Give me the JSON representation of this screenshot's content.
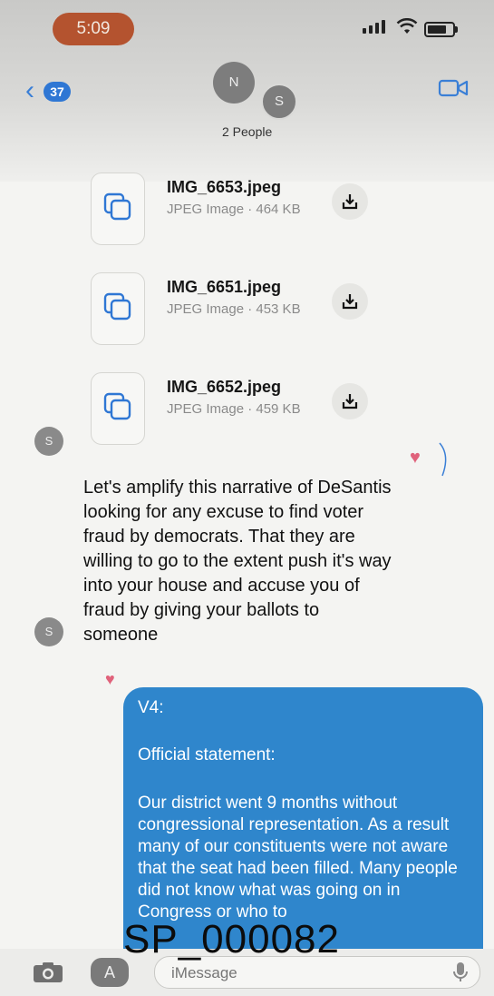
{
  "status_bar": {
    "time": "5:09"
  },
  "header": {
    "back_count": "37",
    "avatars": [
      "N",
      "S"
    ],
    "group_label": "2 People"
  },
  "attachments": [
    {
      "filename": "IMG_6653.jpeg",
      "meta": "JPEG Image · 464 KB"
    },
    {
      "filename": "IMG_6651.jpeg",
      "meta": "JPEG Image · 453 KB"
    },
    {
      "filename": "IMG_6652.jpeg",
      "meta": "JPEG Image · 459 KB"
    }
  ],
  "messages": {
    "sender_initial": "S",
    "text_message": "Let's amplify this narrative of DeSantis looking for any excuse to find voter fraud by democrats. That they are willing to go to the extent push it's way into your house and accuse you of fraud by giving your ballots to someone",
    "outgoing": {
      "line1": "V4:",
      "line2": "Official statement:",
      "body": "Our district went 9 months without congressional representation. As a result many of our constituents were not aware that the seat had been filled. Many people did not know what was going on in Congress or who to"
    }
  },
  "input_bar": {
    "apps_glyph": "A",
    "placeholder": "iMessage"
  },
  "bates_stamp": "SP_000082",
  "colors": {
    "bubble_blue": "#2f86cc",
    "time_pill": "#b4532f",
    "heart": "#e0627b",
    "link_blue": "#3a7fd6"
  },
  "icons": {
    "back": "chevron-left-icon",
    "video": "video-camera-icon",
    "attachment": "photos-stack-icon",
    "download": "download-icon",
    "camera": "camera-icon",
    "mic": "microphone-icon",
    "heart": "heart-icon"
  }
}
